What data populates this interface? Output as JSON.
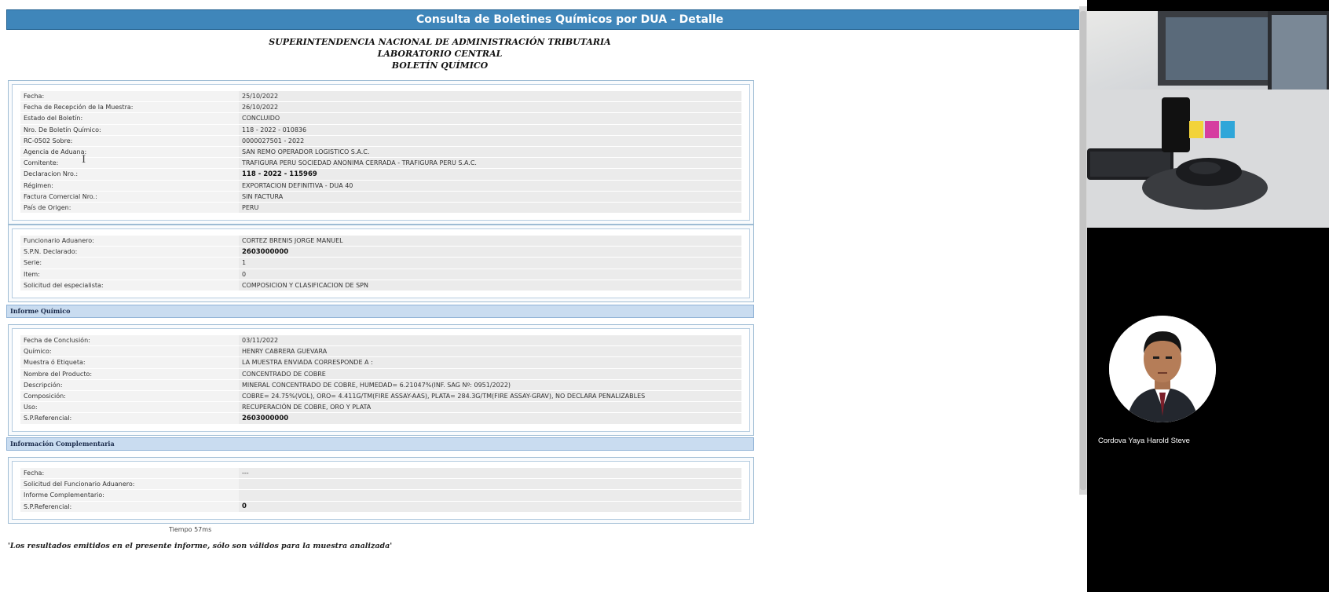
{
  "page": {
    "title": "Consulta de Boletines Químicos por DUA - Detalle",
    "org_line1": "SUPERINTENDENCIA NACIONAL DE ADMINISTRACIÓN TRIBUTARIA",
    "org_line2": "LABORATORIO CENTRAL",
    "org_line3": "BOLETÍN QUÍMICO"
  },
  "general": {
    "rows": [
      {
        "label": "Fecha:",
        "value": "25/10/2022"
      },
      {
        "label": "Fecha de Recepción de la Muestra:",
        "value": "26/10/2022"
      },
      {
        "label": "Estado del Boletín:",
        "value": "CONCLUIDO"
      },
      {
        "label": "Nro. De Boletín Químico:",
        "value": "118 - 2022 - 010836"
      },
      {
        "label": "RC-0502 Sobre:",
        "value": "0000027501 - 2022"
      },
      {
        "label": "Agencia de Aduana:",
        "value": "SAN REMO OPERADOR LOGISTICO S.A.C."
      },
      {
        "label": "Comitente:",
        "value": "TRAFIGURA PERU SOCIEDAD ANONIMA CERRADA - TRAFIGURA PERU S.A.C."
      },
      {
        "label": "Declaracion Nro.:",
        "value": "118 - 2022 - 115969"
      },
      {
        "label": "Régimen:",
        "value": "EXPORTACION DEFINITIVA - DUA 40"
      },
      {
        "label": "Factura Comercial Nro.:",
        "value": "SIN FACTURA"
      },
      {
        "label": "País de Origen:",
        "value": "PERU"
      }
    ]
  },
  "funcionario": {
    "rows": [
      {
        "label": "Funcionario Aduanero:",
        "value": "CORTEZ BRENIS JORGE MANUEL"
      },
      {
        "label": "S.P.N. Declarado:",
        "value": "2603000000"
      },
      {
        "label": "Serie:",
        "value": "1"
      },
      {
        "label": "Item:",
        "value": "0"
      },
      {
        "label": "Solicitud del especialista:",
        "value": "COMPOSICION Y CLASIFICACION DE SPN"
      }
    ]
  },
  "informe": {
    "header": "Informe Químico",
    "rows": [
      {
        "label": "Fecha de Conclusión:",
        "value": "03/11/2022"
      },
      {
        "label": "Químico:",
        "value": "HENRY CABRERA GUEVARA"
      },
      {
        "label": "Muestra ó Etiqueta:",
        "value": "LA MUESTRA ENVIADA CORRESPONDE A :"
      },
      {
        "label": "Nombre del Producto:",
        "value": "CONCENTRADO DE COBRE"
      },
      {
        "label": "Descripción:",
        "value": "MINERAL CONCENTRADO DE COBRE, HUMEDAD= 6.21047%(INF. SAG Nº: 0951/2022)"
      },
      {
        "label": "Composición:",
        "value": "COBRE= 24.75%(VOL), ORO= 4.411G/TM(FIRE ASSAY-AAS), PLATA= 284.3G/TM(FIRE ASSAY-GRAV), NO DECLARA PENALIZABLES"
      },
      {
        "label": "Uso:",
        "value": "RECUPERACIÓN DE COBRE, ORO Y PLATA"
      },
      {
        "label": "S.P.Referencial:",
        "value": "2603000000"
      }
    ]
  },
  "complementaria": {
    "header": "Información Complementaria",
    "rows": [
      {
        "label": "Fecha:",
        "value": "---"
      },
      {
        "label": "Solicitud del Funcionario Aduanero:",
        "value": ""
      },
      {
        "label": "Informe Complementario:",
        "value": ""
      },
      {
        "label": "S.P.Referencial:",
        "value": "0"
      }
    ]
  },
  "footer": {
    "tiempo": "Tiempo 57ms",
    "disclaimer": "'Los resultados emitidos en el presente informe, sólo son válidos para la muestra analizada'"
  },
  "video_call": {
    "participant_name": "Cordova Yaya Harold Steve"
  }
}
